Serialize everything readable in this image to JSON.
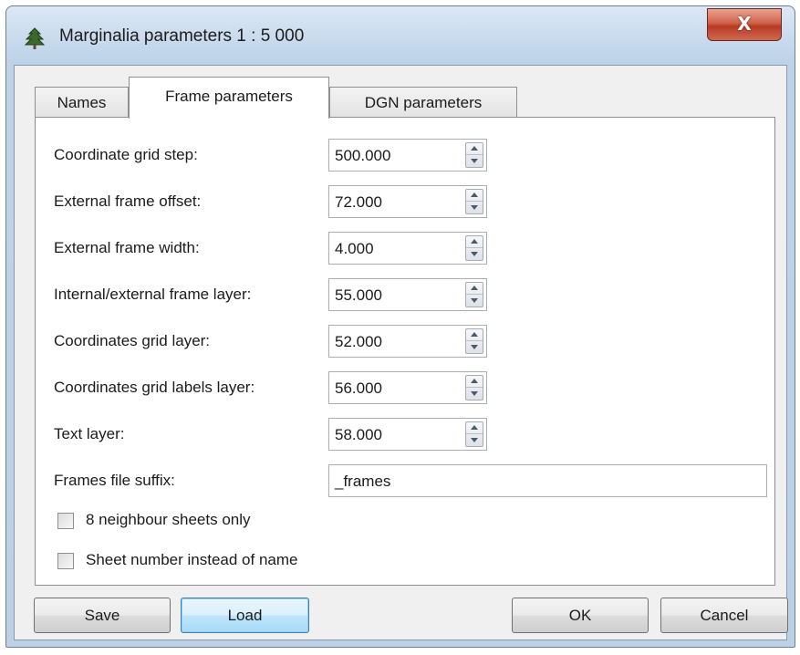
{
  "window": {
    "title": "Marginalia parameters 1 : 5 000",
    "icon": "tree-icon",
    "close_glyph": "X"
  },
  "tabs": [
    {
      "label": "Names",
      "active": false
    },
    {
      "label": "Frame parameters",
      "active": true
    },
    {
      "label": "DGN parameters",
      "active": false
    }
  ],
  "fields": [
    {
      "label": "Coordinate grid step:",
      "value": "500.000"
    },
    {
      "label": "External frame offset:",
      "value": "72.000"
    },
    {
      "label": "External frame width:",
      "value": "4.000"
    },
    {
      "label": "Internal/external frame layer:",
      "value": "55.000"
    },
    {
      "label": "Coordinates grid layer:",
      "value": "52.000"
    },
    {
      "label": "Coordinates grid labels layer:",
      "value": "56.000"
    },
    {
      "label": "Text layer:",
      "value": "58.000"
    }
  ],
  "suffix": {
    "label": "Frames file suffix:",
    "value": "_frames"
  },
  "checkboxes": [
    {
      "label": "8 neighbour sheets only",
      "checked": false
    },
    {
      "label": "Sheet number instead of name",
      "checked": false
    }
  ],
  "buttons": {
    "save": "Save",
    "load": "Load",
    "ok": "OK",
    "cancel": "Cancel"
  },
  "colors": {
    "title_bar": "#c7d9ec",
    "close_button": "#c7503a",
    "default_button_border": "#3c7fb1"
  }
}
